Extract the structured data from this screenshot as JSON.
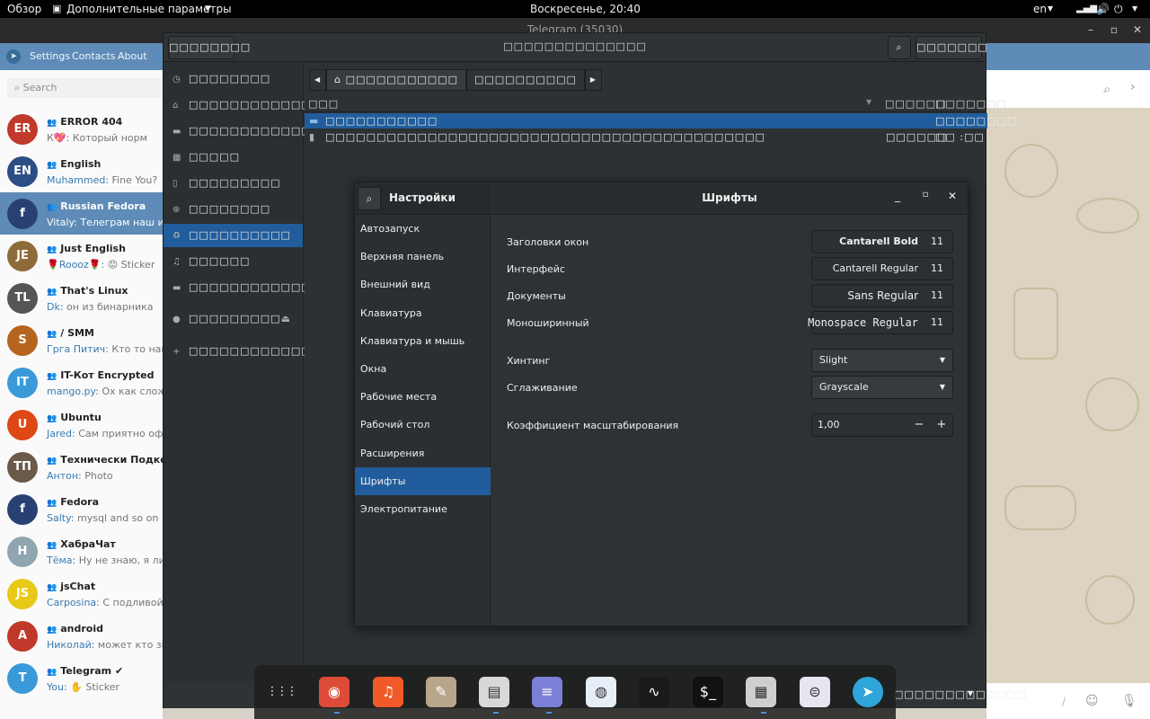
{
  "topbar": {
    "activities": "Обзор",
    "app_menu": "Дополнительные параметры",
    "clock": "Воскресенье, 20:40",
    "lang": "en"
  },
  "telegram": {
    "title": "Telegram (35030)",
    "menu": [
      "Settings",
      "Contacts",
      "About"
    ],
    "search_placeholder": "Search",
    "chats": [
      {
        "name": "ERROR 404",
        "sender": "",
        "preview": "К💖: Который норм",
        "color": "#c0392b",
        "initial": "ER"
      },
      {
        "name": "English",
        "sender": "Muhammed:",
        "preview": " Fine  You?",
        "color": "#2c4e86",
        "initial": "EN"
      },
      {
        "name": "Russian Fedora",
        "sender": "Vitaly:",
        "preview": " Телеграм наш или д",
        "color": "#294172",
        "initial": "f"
      },
      {
        "name": "Just English",
        "sender": "🌹Roooz🌹:",
        "preview": " 😡 Sticker",
        "color": "#8e6b3a",
        "initial": "JE"
      },
      {
        "name": "That's Linux",
        "sender": "Dk:",
        "preview": " он из бинарника",
        "color": "#555555",
        "initial": "TL"
      },
      {
        "name": "/ SMM",
        "sender": "Грга Питич:",
        "preview": " Кто то нагонит",
        "color": "#b5651d",
        "initial": "S"
      },
      {
        "name": "IT-Кот Encrypted",
        "sender": "mango.py:",
        "preview": " Ох как сложно",
        "color": "#3a9ad9",
        "initial": "IT"
      },
      {
        "name": "Ubuntu",
        "sender": "Jared:",
        "preview": " Сам приятно офигев",
        "color": "#dd4814",
        "initial": "U"
      },
      {
        "name": "Технически Подкован",
        "sender": "Антон:",
        "preview": " Photo",
        "color": "#6b5a4a",
        "initial": "ТП"
      },
      {
        "name": "Fedora",
        "sender": "Salty:",
        "preview": " mysql and so on",
        "color": "#294172",
        "initial": "f"
      },
      {
        "name": "ХабраЧат",
        "sender": "Тёма:",
        "preview": " Ну не знаю, я лично",
        "color": "#8fa5b0",
        "initial": "H"
      },
      {
        "name": "jsChat",
        "sender": "Carposina:",
        "preview": " С подливой.",
        "color": "#e8c818",
        "initial": "JS"
      },
      {
        "name": "android",
        "sender": "Николай:",
        "preview": " может кто знает?",
        "color": "#c0392b",
        "initial": "A"
      },
      {
        "name": "Telegram ✔",
        "sender": "You:",
        "preview": " ✋ Sticker",
        "color": "#3a9ad9",
        "initial": "T"
      }
    ]
  },
  "file_manager": {
    "header_left": "□□□□□□□□",
    "title": "□□□□□□□□□□□□□□",
    "header_right": "□□□□□□□",
    "places": [
      {
        "icon": "clock",
        "label": "□□□□□□□□"
      },
      {
        "icon": "home",
        "label": "□□□□□□□□□□□□□□□"
      },
      {
        "icon": "folder",
        "label": "□□□□□□□□□□□□"
      },
      {
        "icon": "film",
        "label": "□□□□□"
      },
      {
        "icon": "doc",
        "label": "□□□□□□□□□"
      },
      {
        "icon": "download",
        "label": "□□□□□□□□"
      },
      {
        "icon": "trash",
        "label": "□□□□□□□□□□",
        "active": true
      },
      {
        "icon": "music",
        "label": "□□□□□□"
      },
      {
        "icon": "folder",
        "label": "□□□□□□□□□□□□□□□□"
      },
      {
        "icon": "disk",
        "label": "□□□□□□□□□"
      },
      {
        "icon": "plus",
        "label": "□□□□□□□□□□□□"
      }
    ],
    "path": [
      "□□□□□□□□□□□",
      "□□□□□□□□□□"
    ],
    "columns": [
      "□□□",
      "□□□□□□",
      "□□□□□□□"
    ],
    "rows": [
      {
        "name": "□□□□□□□□□□□",
        "size": "",
        "mod": "□□□□□□□□"
      },
      {
        "name": "□□□□□□□□□□□□□□□□□□□□□□□□□□□□□□□□□□□□□□□□□□□",
        "size": "□□□□□□",
        "mod": "□□ :□□"
      }
    ],
    "status_right": "□□□□□□□□□□□□□"
  },
  "settings": {
    "app_title": "Настройки",
    "page_title": "Шрифты",
    "nav": [
      "Автозапуск",
      "Верхняя панель",
      "Внешний вид",
      "Клавиатура",
      "Клавиатура и мышь",
      "Окна",
      "Рабочие места",
      "Рабочий стол",
      "Расширения",
      "Шрифты",
      "Электропитание"
    ],
    "active_nav_index": 9,
    "fonts": [
      {
        "label": "Заголовки окон",
        "font": "Cantarell Bold",
        "size": "11"
      },
      {
        "label": "Интерфейс",
        "font": "Cantarell Regular",
        "size": "11"
      },
      {
        "label": "Документы",
        "font": "Sans Regular",
        "size": "11"
      },
      {
        "label": "Моноширинный",
        "font": "Monospace Regular",
        "size": "11"
      }
    ],
    "hinting": {
      "label": "Хинтинг",
      "value": "Slight"
    },
    "antialiasing": {
      "label": "Сглаживание",
      "value": "Grayscale"
    },
    "scaling": {
      "label": "Коэффициент масштабирования",
      "value": "1,00"
    }
  },
  "dock": {
    "apps": [
      {
        "name": "app-grid-icon",
        "glyph": "⋮⋮⋮",
        "color": "transparent"
      },
      {
        "name": "chrome-icon",
        "glyph": "◉",
        "color": "#dd4b39"
      },
      {
        "name": "music-icon",
        "glyph": "♫",
        "color": "#f05a28"
      },
      {
        "name": "gimp-icon",
        "glyph": "✎",
        "color": "#b8a58c"
      },
      {
        "name": "files-icon",
        "glyph": "▤",
        "color": "#d8d8d8"
      },
      {
        "name": "text-editor-icon",
        "glyph": "≡",
        "color": "#7b7fd6"
      },
      {
        "name": "browser-icon",
        "glyph": "◍",
        "color": "#e6eef7"
      },
      {
        "name": "system-monitor-icon",
        "glyph": "∿",
        "color": "#1a1a1a"
      },
      {
        "name": "terminal-icon",
        "glyph": "$_",
        "color": "#111111"
      },
      {
        "name": "disks-icon",
        "glyph": "▦",
        "color": "#cfcfcf"
      },
      {
        "name": "tweaks-icon",
        "glyph": "⊜",
        "color": "#e8e4f0"
      },
      {
        "name": "telegram-icon",
        "glyph": "➤",
        "color": "#2ea6da"
      }
    ]
  }
}
